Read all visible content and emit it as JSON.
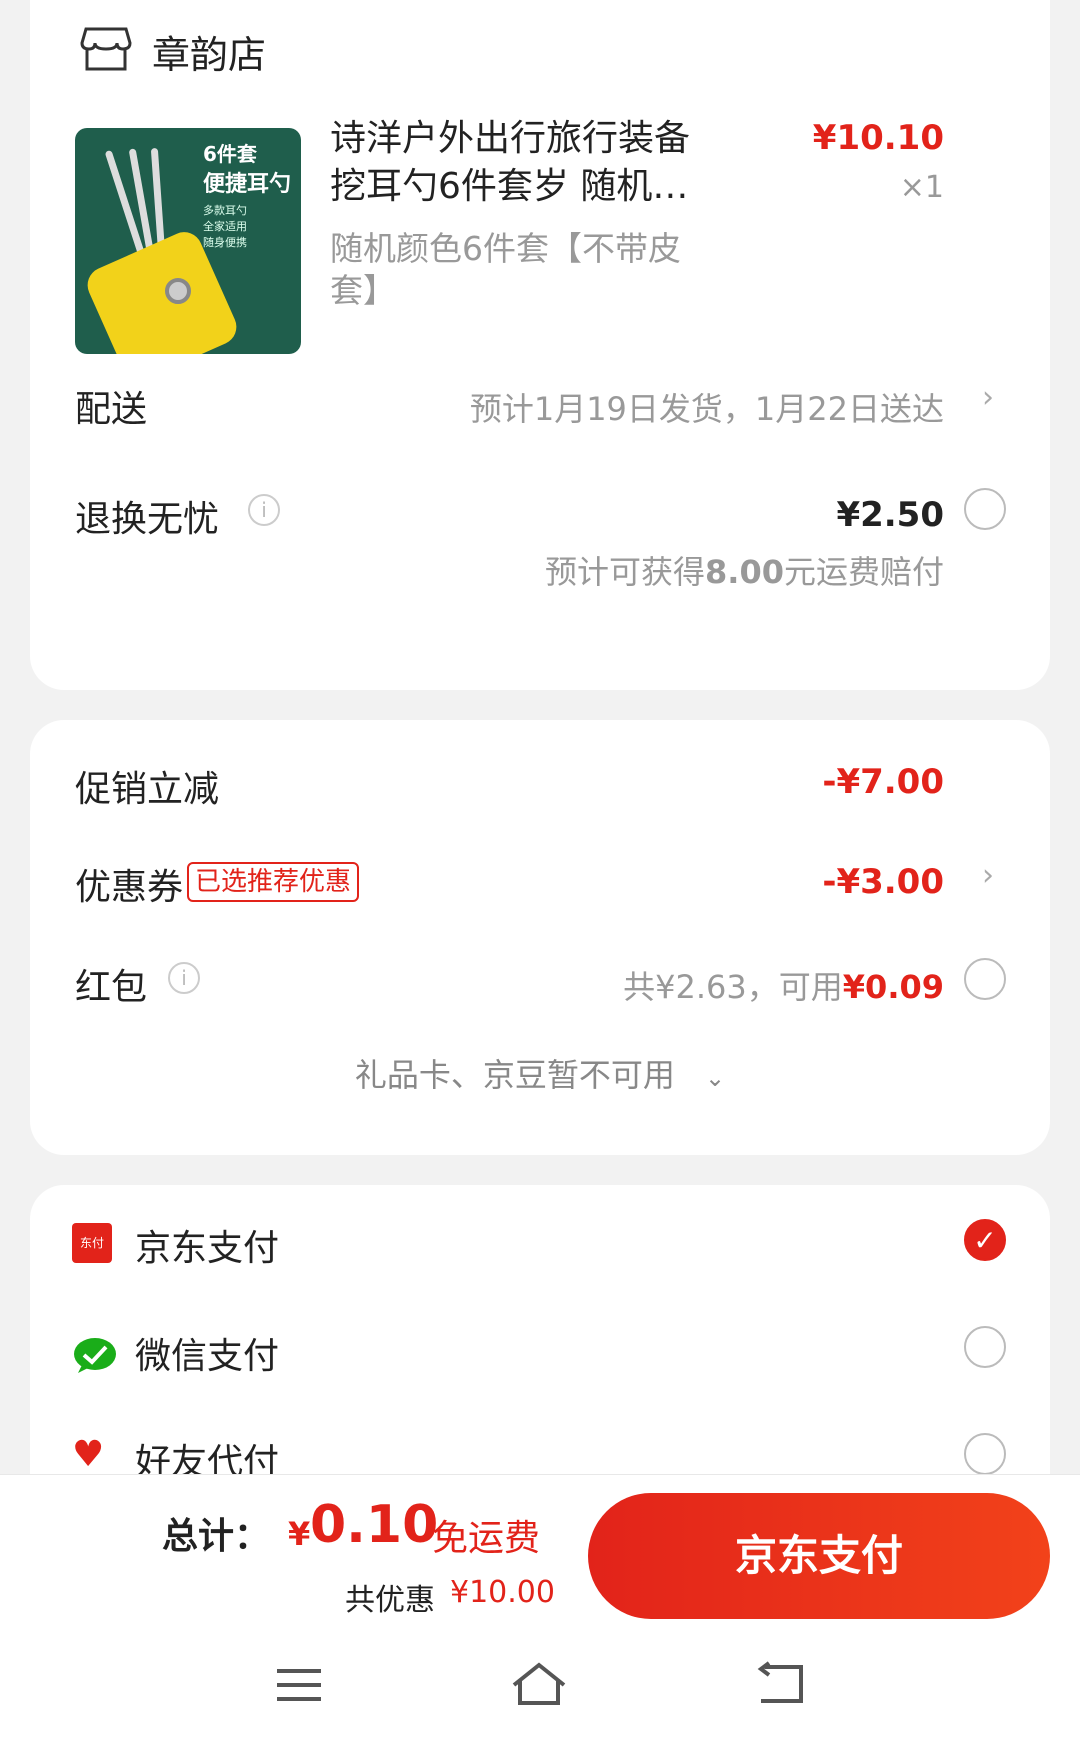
{
  "store": {
    "name": "章韵店",
    "icon": "store-icon"
  },
  "product": {
    "title": "诗洋户外出行旅行装备挖耳勺6件套岁 随机…",
    "spec": "随机颜色6件套【不带皮套】",
    "price": "¥10.10",
    "qty": "×1",
    "image_text": {
      "count": "6件套",
      "name": "便捷耳勺",
      "features": [
        "多款耳勺",
        "全家适用",
        "随身便携"
      ]
    }
  },
  "delivery": {
    "label": "配送",
    "value": "预计1月19日发货，1月22日送达"
  },
  "return_service": {
    "label": "退换无忧",
    "price": "¥2.50",
    "note_prefix": "预计可获得",
    "note_amount": "8.00",
    "note_suffix": "元运费赔付"
  },
  "discounts": {
    "promo": {
      "label": "促销立减",
      "value": "-¥7.00"
    },
    "coupon": {
      "label": "优惠券",
      "badge": "已选推荐优惠",
      "value": "-¥3.00"
    },
    "redpacket": {
      "label": "红包",
      "total": "共¥2.63，可用",
      "usable": "¥0.09"
    },
    "unavailable": "礼品卡、京豆暂不可用"
  },
  "payment_methods": [
    {
      "label": "京东支付",
      "selected": true,
      "icon": "jd-pay-icon"
    },
    {
      "label": "微信支付",
      "selected": false,
      "icon": "wechat-icon"
    },
    {
      "label": "好友代付",
      "selected": false,
      "icon": "heart-icon"
    }
  ],
  "bottom": {
    "total_label": "总计：",
    "total_currency": "¥",
    "total_value": "0.10",
    "shipping": "免运费",
    "saved_label": "共优惠",
    "saved_value": "¥10.00",
    "pay_button": "京东支付"
  },
  "colors": {
    "accent": "#e2231a",
    "background": "#f2f2f2"
  }
}
